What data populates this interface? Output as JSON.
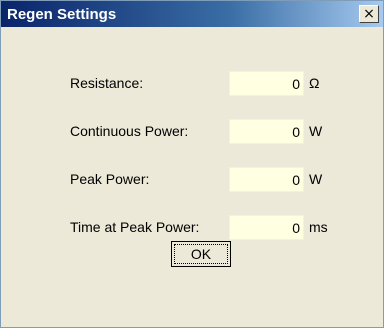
{
  "window": {
    "title": "Regen Settings",
    "close_glyph": "×"
  },
  "fields": [
    {
      "label": "Resistance:",
      "value": "0",
      "unit": "Ω"
    },
    {
      "label": "Continuous Power:",
      "value": "0",
      "unit": "W"
    },
    {
      "label": "Peak Power:",
      "value": "0",
      "unit": "W"
    },
    {
      "label": "Time at Peak Power:",
      "value": "0",
      "unit": "ms"
    }
  ],
  "buttons": {
    "ok_label": "OK"
  },
  "colors": {
    "title_start": "#0a246a",
    "title_end": "#a6caf0",
    "dialog_bg": "#ece9d8",
    "field_bg": "#ffffe1"
  }
}
